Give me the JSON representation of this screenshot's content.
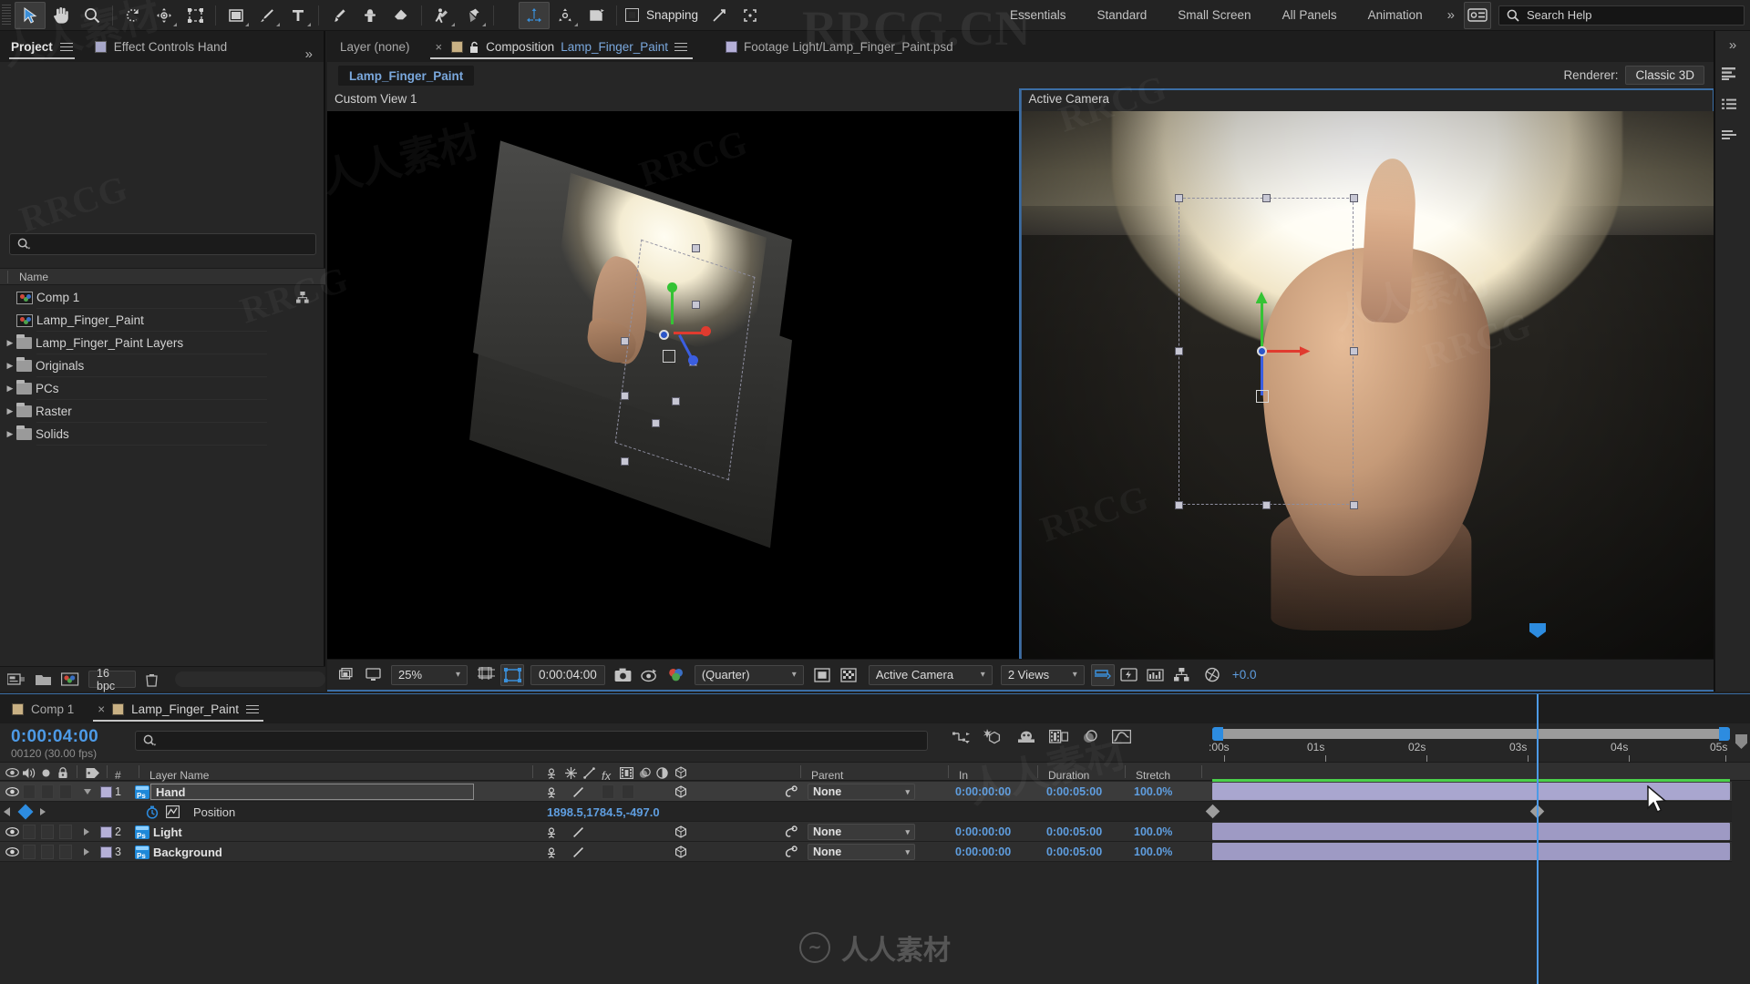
{
  "toolbar": {
    "tools": [
      {
        "name": "selection-tool",
        "selected": true
      },
      {
        "name": "hand-tool",
        "selected": false
      },
      {
        "name": "zoom-tool",
        "selected": false
      },
      {
        "name": "orbit-tool",
        "selected": false
      },
      {
        "name": "pan-behind-tool",
        "selected": false
      },
      {
        "name": "mask-tool",
        "selected": false
      },
      {
        "name": "shape-tool",
        "selected": false
      },
      {
        "name": "pen-tool",
        "selected": false
      },
      {
        "name": "type-tool",
        "selected": false
      },
      {
        "name": "brush-tool",
        "selected": false
      },
      {
        "name": "clone-stamp-tool",
        "selected": false
      },
      {
        "name": "eraser-tool",
        "selected": false
      },
      {
        "name": "roto-brush-tool",
        "selected": false
      },
      {
        "name": "puppet-pin-tool",
        "selected": false
      }
    ],
    "camera_tools": [
      {
        "name": "unified-camera-tool",
        "selected": true
      },
      {
        "name": "orbit-camera-tool",
        "selected": false
      },
      {
        "name": "track-camera-tool",
        "selected": false
      }
    ],
    "snapping_label": "Snapping",
    "snapping_checked": false,
    "workspaces": [
      "Essentials",
      "Standard",
      "Small Screen",
      "All Panels",
      "Animation"
    ],
    "workspace_overflow": "»",
    "search_help_placeholder": "Search Help"
  },
  "project_panel": {
    "tabs": [
      {
        "label": "Project",
        "active": true
      },
      {
        "label": "Effect Controls Hand",
        "active": false
      }
    ],
    "overflow": "»",
    "search_value": "",
    "column_header": "Name",
    "items": [
      {
        "label": "Comp 1",
        "type": "comp",
        "expandable": false,
        "flow": true
      },
      {
        "label": "Lamp_Finger_Paint",
        "type": "comp",
        "expandable": false,
        "flow": false
      },
      {
        "label": "Lamp_Finger_Paint Layers",
        "type": "folder",
        "expandable": true,
        "flow": false
      },
      {
        "label": "Originals",
        "type": "folder",
        "expandable": true,
        "flow": false
      },
      {
        "label": "PCs",
        "type": "folder",
        "expandable": true,
        "flow": false
      },
      {
        "label": "Raster",
        "type": "folder",
        "expandable": true,
        "flow": false
      },
      {
        "label": "Solids",
        "type": "folder",
        "expandable": true,
        "flow": false
      }
    ],
    "footer": {
      "bit_depth": "16 bpc",
      "icons": [
        "interpret-footage-icon",
        "new-folder-icon",
        "new-comp-icon",
        "delete-icon"
      ]
    }
  },
  "viewer": {
    "tabs": [
      {
        "label": "Layer (none)",
        "active": false,
        "swatch": null,
        "closeable": false
      },
      {
        "label_prefix": "Composition",
        "label": "Lamp_Finger_Paint",
        "active": true,
        "swatch": "#c9b184",
        "closeable": true,
        "locked": true,
        "menu": true
      },
      {
        "label": "Footage Light/Lamp_Finger_Paint.psd",
        "active": false,
        "swatch": "#b5b0d8",
        "closeable": false
      }
    ],
    "comp_chip": "Lamp_Finger_Paint",
    "renderer_label": "Renderer:",
    "renderer_value": "Classic 3D",
    "views": [
      {
        "label": "Custom View 1",
        "active": false
      },
      {
        "label": "Active Camera",
        "active": true
      }
    ],
    "bottom_bar": {
      "zoom": "25%",
      "timecode": "0:00:04:00",
      "resolution": "(Quarter)",
      "camera": "Active Camera",
      "view_layout": "2 Views",
      "exposure": "+0.0",
      "icons": [
        "main-viewer-icon",
        "pixel-aspect-icon",
        "resolution-icon",
        "region-of-interest-icon",
        "transparency-grid-icon",
        "take-snapshot-icon",
        "show-snapshot-icon",
        "channels-icon",
        "toggle-mask-icon",
        "title-safe-icon",
        "fast-previews-icon",
        "timeline-icon",
        "comp-flowchart-icon",
        "reset-exposure-icon"
      ]
    }
  },
  "right_rail": {
    "overflow": "»",
    "icons": [
      "align-panel-icon",
      "character-panel-icon",
      "paragraph-panel-icon"
    ]
  },
  "timeline": {
    "tabs": [
      {
        "label": "Comp 1",
        "active": false,
        "swatch": "#c9b184",
        "closeable": false
      },
      {
        "label": "Lamp_Finger_Paint",
        "active": true,
        "swatch": "#c9b184",
        "closeable": true,
        "menu": true
      }
    ],
    "current_time": "0:00:04:00",
    "frame_info": "00120 (30.00 fps)",
    "search_value": "",
    "switch_icons": [
      "composition-mini-flowchart-icon",
      "draft-3d-icon",
      "hide-shy-layers-icon",
      "enable-frame-blending-icon",
      "enable-motion-blur-icon",
      "graph-editor-icon"
    ],
    "columns": {
      "av_features": [
        "video-toggle",
        "audio-toggle",
        "solo-toggle",
        "lock-toggle"
      ],
      "label_icon": "label-icon",
      "number": "#",
      "layer_name": "Layer Name",
      "switches": [
        "shy-icon",
        "collapse-transformations-icon",
        "quality-icon",
        "effects-icon",
        "frame-blending-icon",
        "motion-blur-icon",
        "adjustment-layer-icon",
        "3d-layer-icon"
      ],
      "parent": "Parent",
      "in": "In",
      "duration": "Duration",
      "stretch": "Stretch"
    },
    "layers": [
      {
        "index": "1",
        "name": "Hand",
        "selected": true,
        "expanded": true,
        "visible": true,
        "three_d": true,
        "parent": "None",
        "in": "0:00:00:00",
        "duration": "0:00:05:00",
        "stretch": "100.0%",
        "properties": [
          {
            "name": "Position",
            "value": "1898.5,1784.5,-497.0",
            "stopwatch": true,
            "graph": true,
            "keyframes": [
              0,
              4
            ]
          }
        ]
      },
      {
        "index": "2",
        "name": "Light",
        "selected": false,
        "expanded": false,
        "visible": true,
        "three_d": true,
        "parent": "None",
        "in": "0:00:00:00",
        "duration": "0:00:05:00",
        "stretch": "100.0%",
        "properties": []
      },
      {
        "index": "3",
        "name": "Background",
        "selected": false,
        "expanded": false,
        "visible": true,
        "three_d": true,
        "parent": "None",
        "in": "0:00:00:00",
        "duration": "0:00:05:00",
        "stretch": "100.0%",
        "properties": []
      }
    ],
    "ruler": {
      "ticks": [
        ":00s",
        "01s",
        "02s",
        "03s",
        "04s",
        "05s"
      ],
      "playhead_time": "04s",
      "work_area_start": "0s",
      "work_area_end": "5s"
    }
  },
  "watermarks": {
    "latin": "RRCG",
    "site": "RRCG.CN",
    "chinese": "人人素材",
    "brand": "人人素材"
  },
  "colors": {
    "accent_blue": "#4d9ae6",
    "panel_bg": "#262626",
    "toolbar_bg": "#232323",
    "layer_bar": "#a9a6cf",
    "work_area_green": "#4ad04a",
    "label_tan": "#c9b184",
    "label_lavender": "#b5b0d8"
  }
}
